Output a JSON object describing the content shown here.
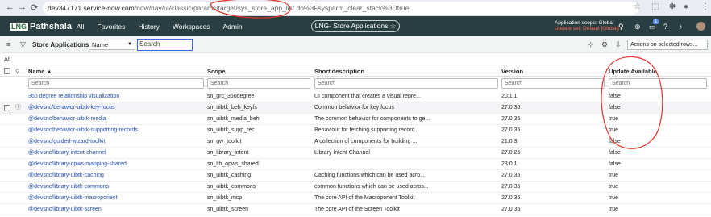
{
  "browser": {
    "back": "←",
    "forward": "→",
    "reload": "⟳",
    "url_prefix": "dev347171.service-now.com",
    "url_rest": "/now/nav/ui/classic/params/target/sys_store_app_list.do%3Fsysparm_clear_stack%3Dtrue",
    "star": "☆"
  },
  "app": {
    "logo_badge": "LNG",
    "logo_text": "Pathshala",
    "nav": [
      "All",
      "Favorites",
      "History",
      "Workspaces",
      "Admin"
    ],
    "page_title": "LNG- Store Applications ☆",
    "scope_line1": "Application scope: Global",
    "scope_line2": "Update set: Default [Global]",
    "badge": "1"
  },
  "listbar": {
    "title": "Store Applications",
    "field_select": "Name",
    "search_value": "Search",
    "actions_label": "Actions on selected rows..."
  },
  "breadcrumb": "All",
  "table": {
    "columns": {
      "name": "Name ▲",
      "scope": "Scope",
      "desc": "Short description",
      "version": "Version",
      "update": "Update Available"
    },
    "filter_placeholder": "Search",
    "rows": [
      [
        "360 degree relationship visualization",
        "sn_grc_360degree",
        "UI component that creates a visual repre...",
        "20.1.1",
        "false"
      ],
      [
        "@devsnc/behavior-uibtk-key-focus",
        "sn_uibtk_beh_keyfs",
        "Common behavior for key focus",
        "27.0.35",
        "false"
      ],
      [
        "@devsnc/behavior-uibtk-media",
        "sn_uibtk_media_beh",
        "The common behavior for components to ge...",
        "27.0.35",
        "true"
      ],
      [
        "@devsnc/behavior-uibtk-supporting-records",
        "sn_uibtk_supp_rec",
        "Behaviour for fetching supporting record...",
        "27.0.35",
        "true"
      ],
      [
        "@devsnc/guided-wizard-toolkit",
        "sn_gw_toolkit",
        "A collection of components for building ...",
        "21.0.3",
        "false"
      ],
      [
        "@devsnc/library-intent-channel",
        "sn_library_intent",
        "Library Intent Channel",
        "27.0.25",
        "false"
      ],
      [
        "@devsnc/library-opws-mapping-shared",
        "sn_lib_opws_shared",
        "",
        "23.0.1",
        "false"
      ],
      [
        "@devsnc/library-uibtk-caching",
        "sn_uibtk_caching",
        "Caching functions which can be used acro...",
        "27.0.35",
        "true"
      ],
      [
        "@devsnc/library-uibtk-commons",
        "sn_uibtk_commons",
        "common functions which can be used acros...",
        "27.0.35",
        "true"
      ],
      [
        "@devsnc/library-uibtk-macroponent",
        "sn_uibtk_mcp",
        "The core API of the Macroponent Toolkit",
        "27.0.35",
        "true"
      ],
      [
        "@devsnc/library-uibtk-screen",
        "sn_uibtk_screen",
        "The core API of the Screen Toolkit",
        "27.0.35",
        "true"
      ]
    ]
  },
  "colors": {
    "appbar": "#293e40",
    "link": "#1f4fb5",
    "annotation": "#e0342a"
  }
}
